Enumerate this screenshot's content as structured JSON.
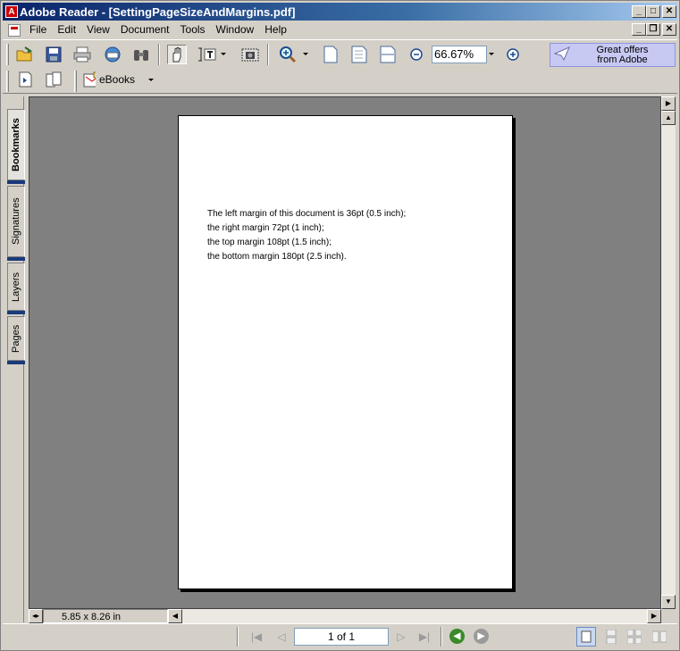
{
  "window": {
    "title": "Adobe Reader - [SettingPageSizeAndMargins.pdf]",
    "app_icon": "adobe-reader-icon",
    "controls": {
      "minimize": "_",
      "maximize": "□",
      "close": "✕"
    }
  },
  "menubar": {
    "items": [
      "File",
      "Edit",
      "View",
      "Document",
      "Tools",
      "Window",
      "Help"
    ],
    "doc_controls": {
      "minimize": "_",
      "restore": "❐",
      "close": "✕"
    }
  },
  "toolbar": {
    "zoom_value": "66.67%",
    "offers_line1": "Great offers",
    "offers_line2": "from Adobe",
    "ebooks_label": "eBooks"
  },
  "nav_tabs": [
    "Bookmarks",
    "Signatures",
    "Layers",
    "Pages"
  ],
  "document": {
    "lines": [
      "The left margin of this document is 36pt (0.5 inch);",
      "the right margin 72pt (1 inch);",
      "the top margin 108pt (1.5 inch);",
      "the bottom margin 180pt (2.5 inch)."
    ]
  },
  "status": {
    "page_size": "5.85 x 8.26 in",
    "page_field": "1 of 1"
  },
  "colors": {
    "title_start": "#0a246a",
    "title_end": "#a6caf0",
    "doc_background": "#808080",
    "offers_bg": "#c7c9f2"
  }
}
